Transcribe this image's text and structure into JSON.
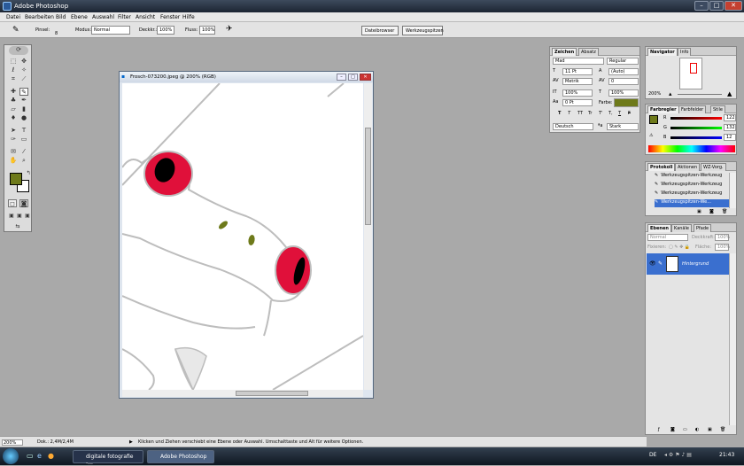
{
  "app": {
    "title": "Adobe Photoshop",
    "min": "–",
    "max": "□",
    "close": "✕"
  },
  "menu": [
    "Datei",
    "Bearbeiten",
    "Bild",
    "Ebene",
    "Auswahl",
    "Filter",
    "Ansicht",
    "Fenster",
    "Hilfe"
  ],
  "options": {
    "pinsel_label": "Pinsel:",
    "pinsel_size": "8",
    "modus_label": "Modus:",
    "modus_value": "Normal",
    "deckkr_label": "Deckkr.:",
    "deckkr_value": "100%",
    "fluss_label": "Fluss:",
    "fluss_value": "100%",
    "tab_dateibrowser": "Dateibrowser",
    "tab_werkzeugspitzen": "Werkzeugspitzen"
  },
  "document": {
    "title": "Frosch-073200.jpeg @ 200% (RGB)",
    "zoom": "200%",
    "doc_size": "Dok.: 2,4M/2,4M"
  },
  "status": {
    "hint": "Klicken und Ziehen verschiebt eine Ebene oder Auswahl. Umschalttaste und Alt für weitere Optionen."
  },
  "zeichen": {
    "tab1": "Zeichen",
    "tab2": "Absatz",
    "font": "Mad",
    "style": "Regular",
    "size": "11 Pt",
    "leading": "(Auto)",
    "kerning": "Metrik",
    "tracking": "0",
    "vscale": "100%",
    "hscale": "100%",
    "baseline": "0 Pt",
    "farbe_label": "Farbe:",
    "farbe_color": "#6e7a1a",
    "lang": "Deutsch",
    "aa": "Stark",
    "styles": [
      "T",
      "T",
      "TT",
      "Tr",
      "T'",
      "T,",
      "T",
      "F"
    ]
  },
  "navigator": {
    "tab1": "Navigator",
    "tab2": "Info",
    "zoom": "200%"
  },
  "farbregler": {
    "tab1": "Farbregler",
    "tab2": "Farbfelder",
    "tab3": "Stile",
    "r_label": "R",
    "g_label": "G",
    "b_label": "B",
    "r": "122",
    "g": "132",
    "b": "12"
  },
  "protokoll": {
    "tab1": "Protokoll",
    "tab2": "Aktionen",
    "tab3": "WZ-Vorg.",
    "items": [
      "Werkzeugspitzen-Werkzeug",
      "Werkzeugspitzen-Werkzeug",
      "Werkzeugspitzen-Werkzeug",
      "Werkzeugspitzen-We..."
    ]
  },
  "ebenen": {
    "tab1": "Ebenen",
    "tab2": "Kanäle",
    "tab3": "Pfade",
    "mode": "Normal",
    "deck_label": "Deckkraft:",
    "deck_value": "100%",
    "fix_label": "Fixieren:",
    "fill_label": "Fläche:",
    "fill_value": "100%",
    "layer": "Hintergrund"
  },
  "taskbar": {
    "item1": "digitale fotografie -...",
    "item2": "Adobe Photoshop",
    "lang": "DE",
    "time": "21:43"
  },
  "colors": {
    "foreground": "#6e7a1a",
    "background": "#ffffff",
    "eye": "#e0103a"
  }
}
